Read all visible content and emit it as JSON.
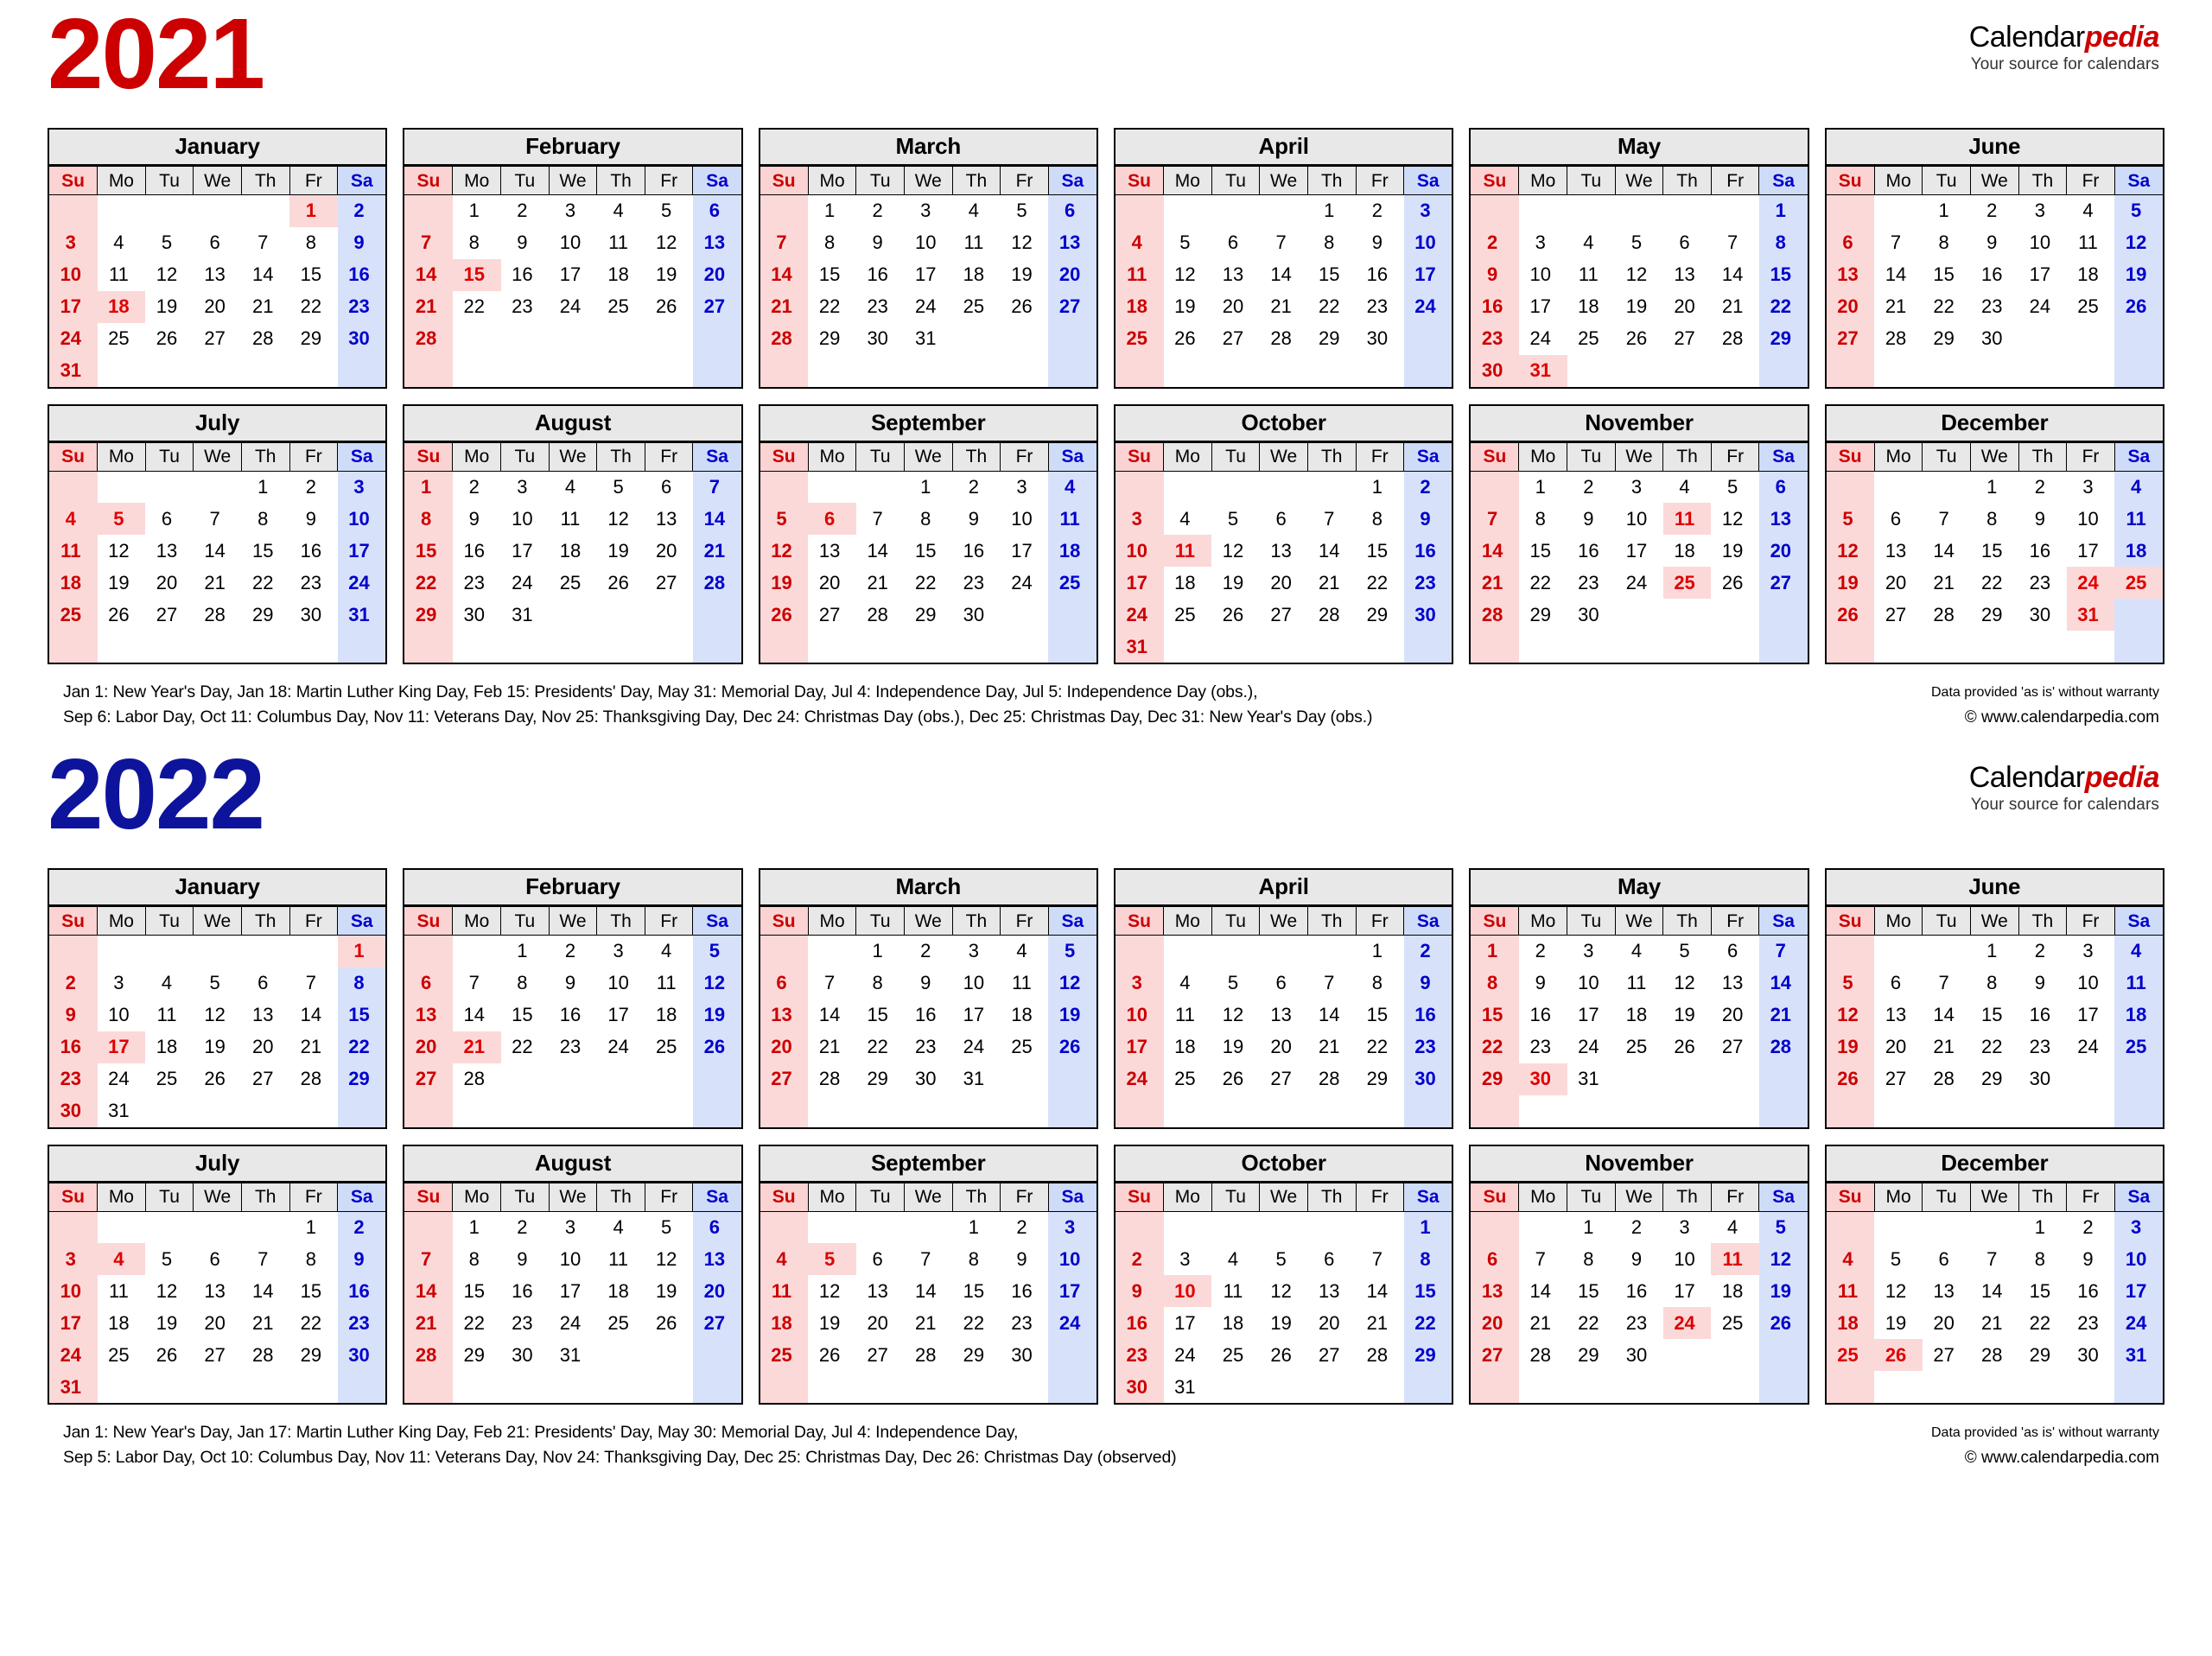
{
  "brand": {
    "name_part1": "Calendar",
    "name_part2": "pedia",
    "tagline": "Your source for calendars"
  },
  "colors": {
    "year_2021": "#cc0000",
    "year_2022": "#0d149b",
    "sunday_bg": "#fbd9d9",
    "saturday_bg": "#d7e2fa",
    "header_bg": "#e8e8e8",
    "holiday_text": "#e00000"
  },
  "weekdays": [
    "Su",
    "Mo",
    "Tu",
    "We",
    "Th",
    "Fr",
    "Sa"
  ],
  "years": [
    {
      "title": "2021",
      "class": "y2021",
      "months": [
        {
          "name": "January",
          "first_dow": 5,
          "days": 31,
          "holidays": [
            1,
            18
          ]
        },
        {
          "name": "February",
          "first_dow": 1,
          "days": 28,
          "holidays": [
            15
          ]
        },
        {
          "name": "March",
          "first_dow": 1,
          "days": 31,
          "holidays": []
        },
        {
          "name": "April",
          "first_dow": 4,
          "days": 30,
          "holidays": []
        },
        {
          "name": "May",
          "first_dow": 6,
          "days": 31,
          "holidays": [
            31
          ]
        },
        {
          "name": "June",
          "first_dow": 2,
          "days": 30,
          "holidays": []
        },
        {
          "name": "July",
          "first_dow": 4,
          "days": 31,
          "holidays": [
            4,
            5
          ]
        },
        {
          "name": "August",
          "first_dow": 0,
          "days": 31,
          "holidays": []
        },
        {
          "name": "September",
          "first_dow": 3,
          "days": 30,
          "holidays": [
            6
          ]
        },
        {
          "name": "October",
          "first_dow": 5,
          "days": 31,
          "holidays": [
            11
          ]
        },
        {
          "name": "November",
          "first_dow": 1,
          "days": 30,
          "holidays": [
            11,
            25
          ]
        },
        {
          "name": "December",
          "first_dow": 3,
          "days": 31,
          "holidays": [
            24,
            25,
            31
          ]
        }
      ],
      "footer_lines": [
        "Jan 1: New Year's Day, Jan 18: Martin Luther King Day, Feb 15: Presidents' Day, May 31: Memorial Day, Jul 4: Independence Day, Jul 5: Independence Day (obs.),",
        "Sep 6: Labor Day, Oct 11: Columbus Day, Nov 11: Veterans Day, Nov 25: Thanksgiving Day, Dec 24: Christmas Day (obs.), Dec 25: Christmas Day, Dec 31: New Year's Day (obs.)"
      ],
      "warranty": "Data provided 'as is' without warranty",
      "copyright": "© www.calendarpedia.com"
    },
    {
      "title": "2022",
      "class": "y2022",
      "months": [
        {
          "name": "January",
          "first_dow": 6,
          "days": 31,
          "holidays": [
            1,
            17
          ]
        },
        {
          "name": "February",
          "first_dow": 2,
          "days": 28,
          "holidays": [
            21
          ]
        },
        {
          "name": "March",
          "first_dow": 2,
          "days": 31,
          "holidays": []
        },
        {
          "name": "April",
          "first_dow": 5,
          "days": 30,
          "holidays": []
        },
        {
          "name": "May",
          "first_dow": 0,
          "days": 31,
          "holidays": [
            30
          ]
        },
        {
          "name": "June",
          "first_dow": 3,
          "days": 30,
          "holidays": []
        },
        {
          "name": "July",
          "first_dow": 5,
          "days": 31,
          "holidays": [
            4
          ]
        },
        {
          "name": "August",
          "first_dow": 1,
          "days": 31,
          "holidays": []
        },
        {
          "name": "September",
          "first_dow": 4,
          "days": 30,
          "holidays": [
            5
          ]
        },
        {
          "name": "October",
          "first_dow": 6,
          "days": 31,
          "holidays": [
            10
          ]
        },
        {
          "name": "November",
          "first_dow": 2,
          "days": 30,
          "holidays": [
            11,
            24
          ]
        },
        {
          "name": "December",
          "first_dow": 4,
          "days": 31,
          "holidays": [
            25,
            26
          ]
        }
      ],
      "footer_lines": [
        "Jan 1: New Year's Day, Jan 17: Martin Luther King Day, Feb 21: Presidents' Day, May 30: Memorial Day, Jul 4: Independence Day,",
        "Sep 5: Labor Day, Oct 10: Columbus Day, Nov 11: Veterans Day, Nov 24: Thanksgiving Day, Dec 25: Christmas Day, Dec 26: Christmas Day (observed)"
      ],
      "warranty": "Data provided 'as is' without warranty",
      "copyright": "© www.calendarpedia.com"
    }
  ]
}
